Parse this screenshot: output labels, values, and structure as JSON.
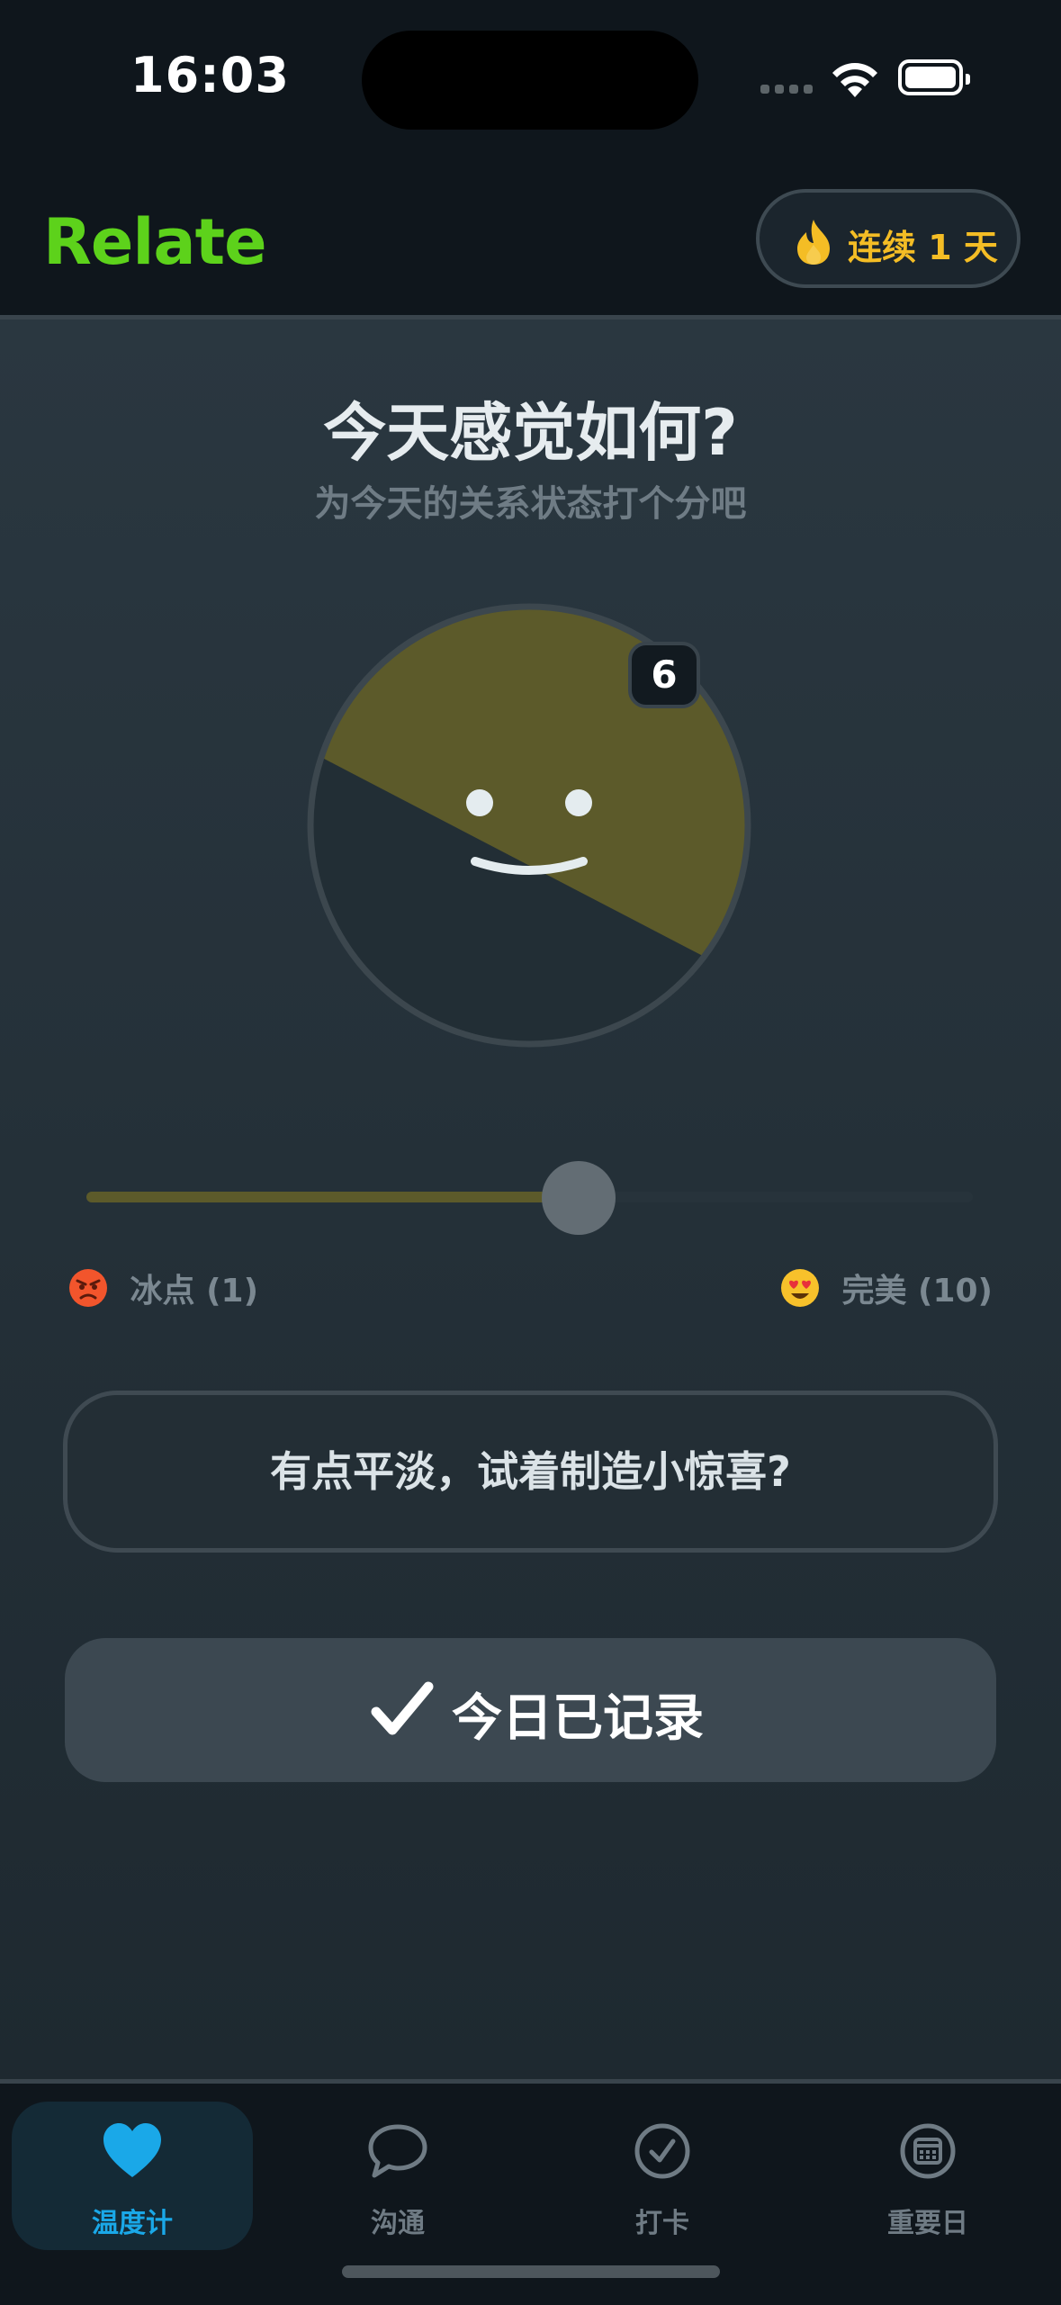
{
  "status_bar": {
    "time": "16:03"
  },
  "header": {
    "brand": "Relate",
    "streak_label": "连续 1 天",
    "streak_icon": "flame-icon",
    "brand_color": "#5dd21b",
    "streak_color": "#f4bd25"
  },
  "mood": {
    "title": "今天感觉如何?",
    "subtitle": "为今天的关系状态打个分吧",
    "score": "6",
    "slider": {
      "min": 1,
      "max": 10,
      "value": 6
    },
    "low_label": "冰点 (1)",
    "high_label": "完美 (10)",
    "low_icon": "angry-face-icon",
    "high_icon": "heart-eyes-face-icon",
    "fill_color": "#5c5a2a"
  },
  "hint": {
    "text": "有点平淡，试着制造小惊喜?"
  },
  "record_button": {
    "label": "今日已记录",
    "icon": "checkmark-icon"
  },
  "tabs": [
    {
      "label": "温度计",
      "icon": "heart-icon",
      "active": true
    },
    {
      "label": "沟通",
      "icon": "chat-bubble-icon",
      "active": false
    },
    {
      "label": "打卡",
      "icon": "check-circle-icon",
      "active": false
    },
    {
      "label": "重要日",
      "icon": "calendar-icon",
      "active": false
    }
  ],
  "accent_color": "#1aa8e8"
}
